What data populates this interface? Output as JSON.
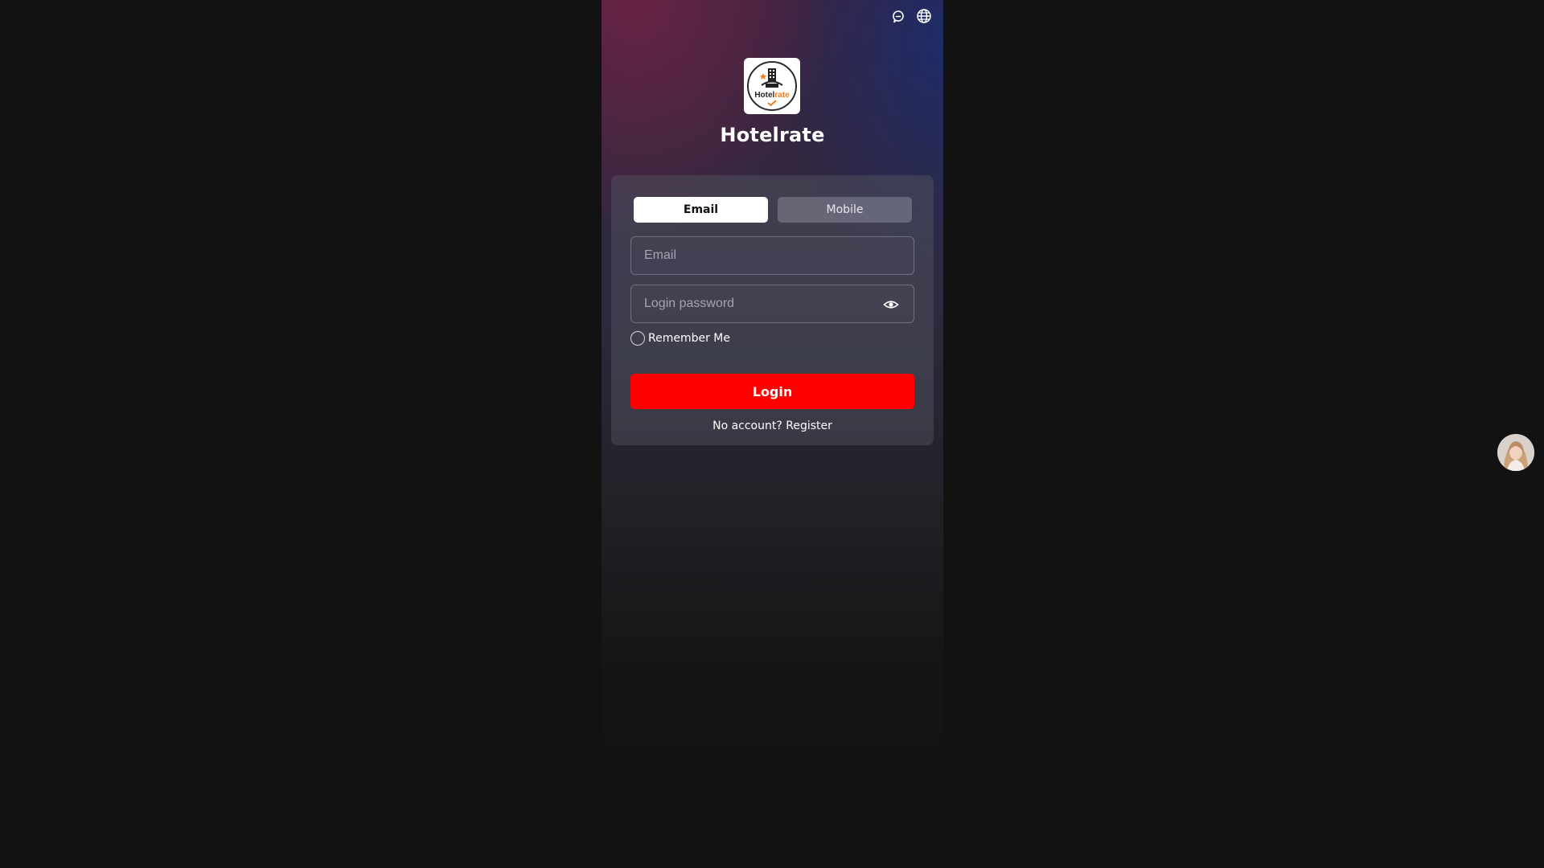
{
  "header": {
    "icons": [
      "support-chat-icon",
      "globe-icon"
    ]
  },
  "brand": {
    "name": "Hotelrate",
    "logo_text_primary": "Hotel",
    "logo_text_accent": "rate",
    "accent_color": "#f07a1e"
  },
  "login": {
    "tabs": [
      {
        "label": "Email",
        "active": true
      },
      {
        "label": "Mobile",
        "active": false
      }
    ],
    "email": {
      "placeholder": "Email",
      "value": ""
    },
    "password": {
      "placeholder": "Login password",
      "value": ""
    },
    "remember_label": "Remember Me",
    "remember_checked": false,
    "login_label": "Login",
    "login_color": "#ff0000",
    "register_prompt": "No account?",
    "register_link": "Register"
  },
  "support": {
    "avatar_icon": "customer-service-avatar"
  }
}
